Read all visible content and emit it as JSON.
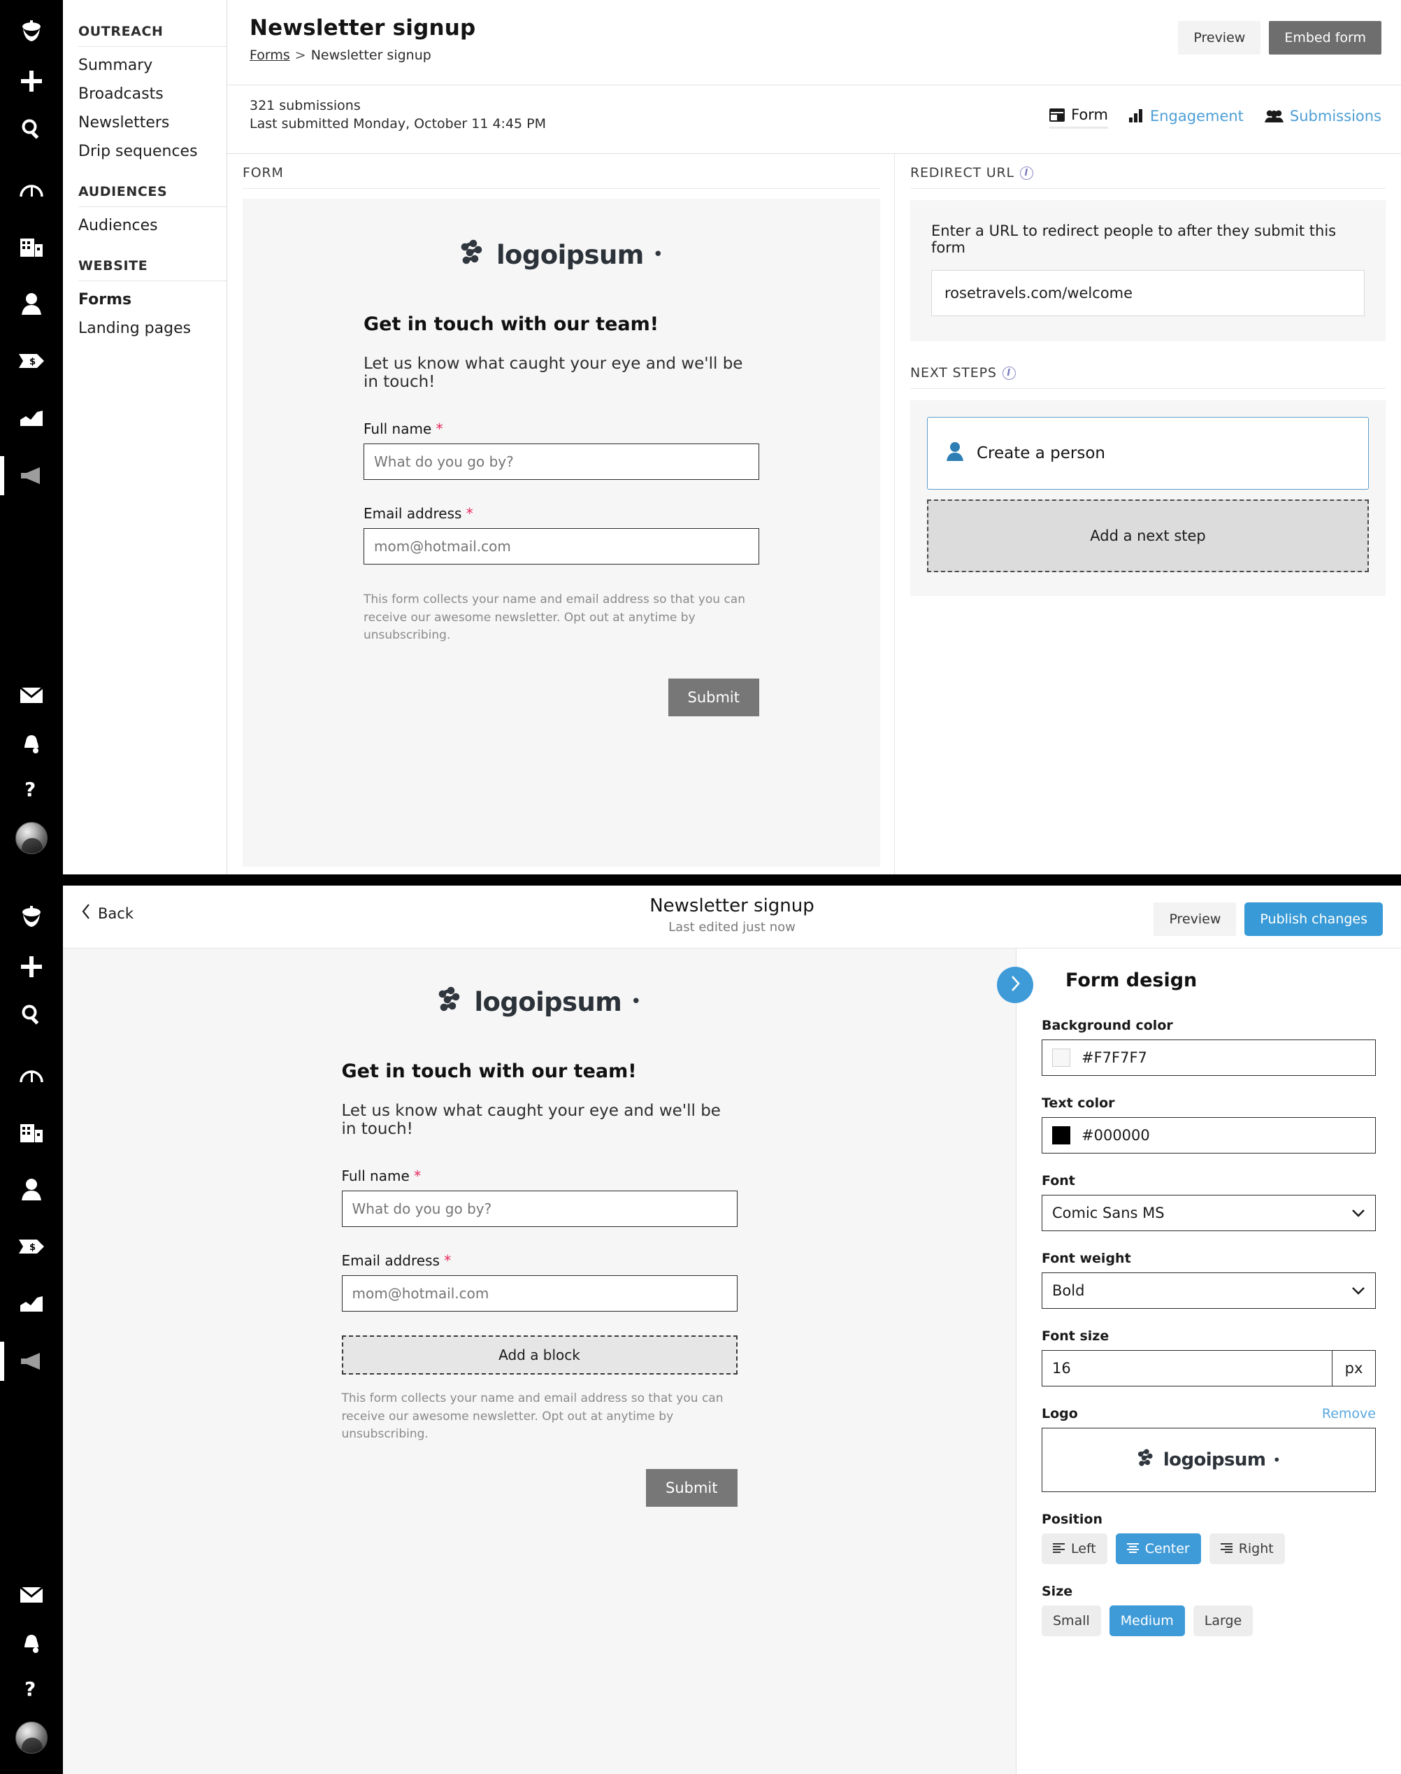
{
  "colors": {
    "accent_blue": "#3F9BD8",
    "link_blue": "#4D9FD6",
    "dark_button": "#6E6E6E",
    "required_red": "#E8255A",
    "form_background": "#F6F6F6"
  },
  "rail": {
    "icons": [
      "acorn-logo-icon",
      "plus-icon",
      "search-icon",
      "gauge-icon",
      "company-icon",
      "person-icon",
      "deal-tag-icon",
      "chart-icon",
      "megaphone-icon"
    ],
    "bottom_icons": [
      "mail-icon",
      "bell-icon",
      "help-icon",
      "avatar"
    ]
  },
  "sidebar": {
    "sections": [
      {
        "title": "OUTREACH",
        "items": [
          {
            "label": "Summary",
            "active": false
          },
          {
            "label": "Broadcasts",
            "active": false
          },
          {
            "label": "Newsletters",
            "active": false
          },
          {
            "label": "Drip sequences",
            "active": false
          }
        ]
      },
      {
        "title": "AUDIENCES",
        "items": [
          {
            "label": "Audiences",
            "active": false
          }
        ]
      },
      {
        "title": "WEBSITE",
        "items": [
          {
            "label": "Forms",
            "active": true
          },
          {
            "label": "Landing pages",
            "active": false
          }
        ]
      }
    ]
  },
  "panel1": {
    "header": {
      "title": "Newsletter signup",
      "breadcrumb_root": "Forms",
      "breadcrumb_sep": ">",
      "breadcrumb_current": "Newsletter signup",
      "preview_label": "Preview",
      "embed_label": "Embed form"
    },
    "summary": {
      "submissions": "321 submissions",
      "last_submitted": "Last submitted Monday, October 11 4:45 PM"
    },
    "tabs": [
      {
        "label": "Form",
        "icon": "form-icon",
        "active": true
      },
      {
        "label": "Engagement",
        "icon": "bar-chart-icon",
        "active": false
      },
      {
        "label": "Submissions",
        "icon": "people-icon",
        "active": false
      }
    ],
    "form_column_label": "FORM",
    "redirect": {
      "section_label": "REDIRECT URL",
      "lead": "Enter a URL to redirect people to after they submit this form",
      "value": "rosetravels.com/welcome",
      "info_icon": "info-icon"
    },
    "next_steps": {
      "section_label": "NEXT STEPS",
      "info_icon": "info-icon",
      "step_label": "Create a person",
      "step_icon": "person-icon",
      "add_label": "Add a next step"
    }
  },
  "form_preview": {
    "logo_text": "logoipsum",
    "logo_mark": "logoipsum-dots-icon",
    "heading": "Get in touch with our team!",
    "subheading": "Let us know what caught your eye and we'll be in touch!",
    "fields": [
      {
        "label": "Full name",
        "required": "*",
        "placeholder": "What do you go by?"
      },
      {
        "label": "Email address",
        "required": "*",
        "placeholder": "mom@hotmail.com"
      }
    ],
    "disclaimer": "This form collects your name and email address so that you can receive our awesome newsletter. Opt out at anytime by unsubscribing.",
    "submit_label": "Submit",
    "add_block_label": "Add a block"
  },
  "panel2": {
    "back_label": "Back",
    "back_icon": "chevron-left-icon",
    "title": "Newsletter signup",
    "subtitle": "Last edited just now",
    "preview_label": "Preview",
    "publish_label": "Publish changes",
    "design": {
      "title": "Form design",
      "collapse_icon": "chevron-right-icon",
      "background_color": {
        "label": "Background color",
        "value": "#F7F7F7"
      },
      "text_color": {
        "label": "Text color",
        "value": "#000000"
      },
      "font": {
        "label": "Font",
        "value": "Comic Sans MS"
      },
      "font_weight": {
        "label": "Font weight",
        "value": "Bold"
      },
      "font_size": {
        "label": "Font size",
        "value": "16",
        "unit": "px"
      },
      "logo": {
        "label": "Logo",
        "remove_label": "Remove",
        "text": "logoipsum"
      },
      "position": {
        "label": "Position",
        "options": [
          {
            "label": "Left",
            "icon": "align-left-icon",
            "selected": false
          },
          {
            "label": "Center",
            "icon": "align-center-icon",
            "selected": true
          },
          {
            "label": "Right",
            "icon": "align-right-icon",
            "selected": false
          }
        ]
      },
      "size": {
        "label": "Size",
        "options": [
          {
            "label": "Small",
            "selected": false
          },
          {
            "label": "Medium",
            "selected": true
          },
          {
            "label": "Large",
            "selected": false
          }
        ]
      }
    }
  }
}
